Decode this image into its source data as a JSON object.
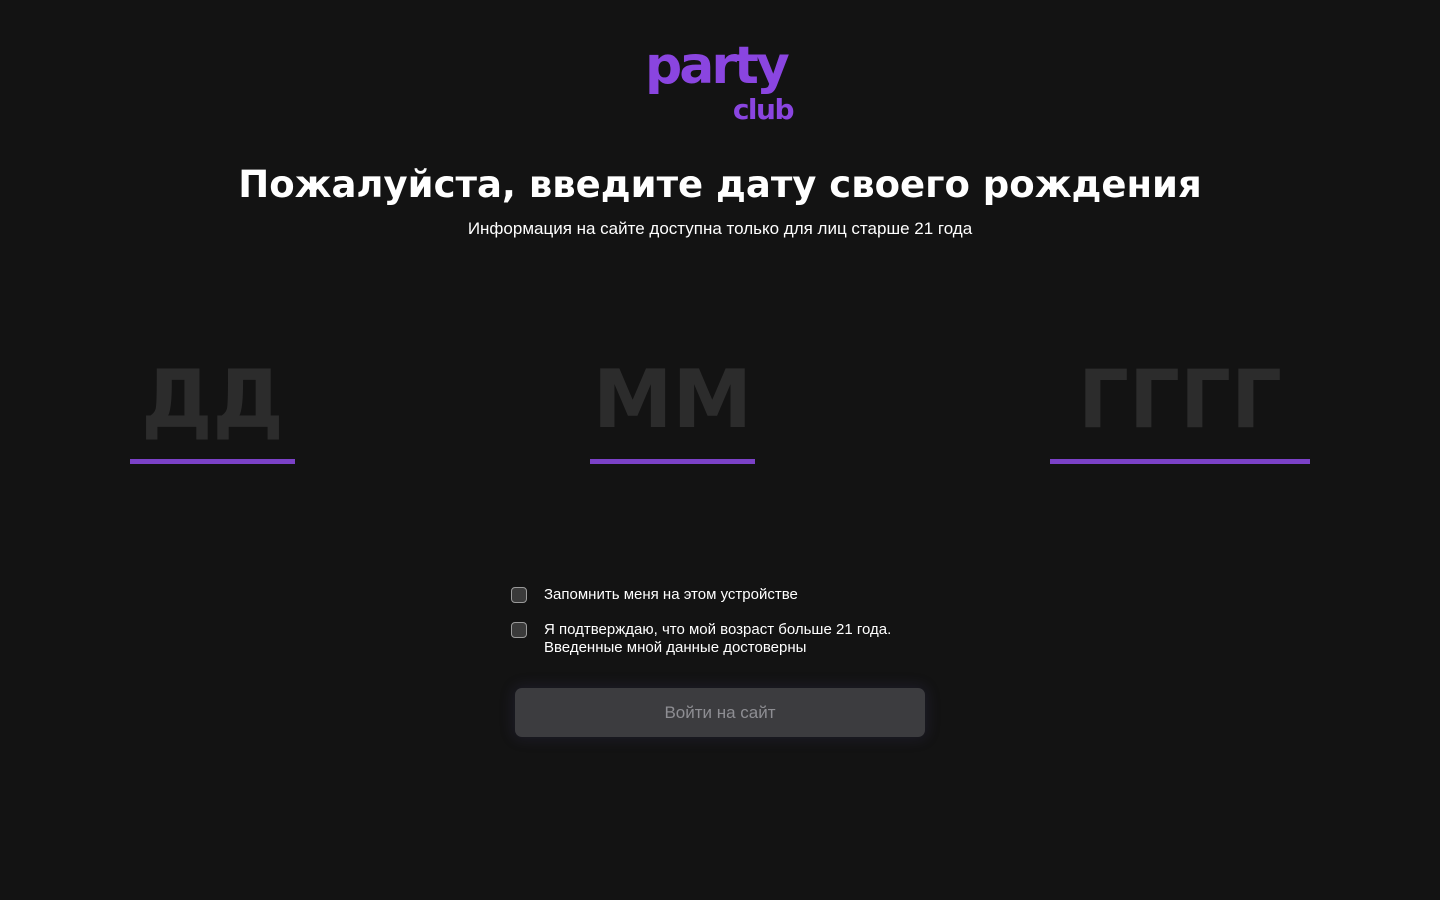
{
  "logo": {
    "line1": "party",
    "line2": "club",
    "color": "#8a45e0"
  },
  "title": "Пожалуйста, введите дату своего рождения",
  "subtitle": "Информация на сайте доступна только для лиц старше 21 года",
  "date_fields": {
    "day": {
      "value": "",
      "placeholder": "ДД"
    },
    "month": {
      "value": "",
      "placeholder": "ММ"
    },
    "year": {
      "value": "",
      "placeholder": "ГГГГ"
    },
    "underline_color": "#7b41c7"
  },
  "checkboxes": {
    "remember": {
      "label": "Запомнить меня на этом устройстве",
      "checked": false
    },
    "confirm_age": {
      "label_line1": "Я подтверждаю, что мой возраст больше 21 года.",
      "label_line2": "Введенные мной данные достоверны",
      "checked": false
    }
  },
  "submit_button": {
    "label": "Войти на сайт",
    "disabled": true
  },
  "colors": {
    "background": "#131313",
    "accent": "#8a45e0",
    "button_bg": "#3c3c3f",
    "button_text": "#8e8e93"
  }
}
